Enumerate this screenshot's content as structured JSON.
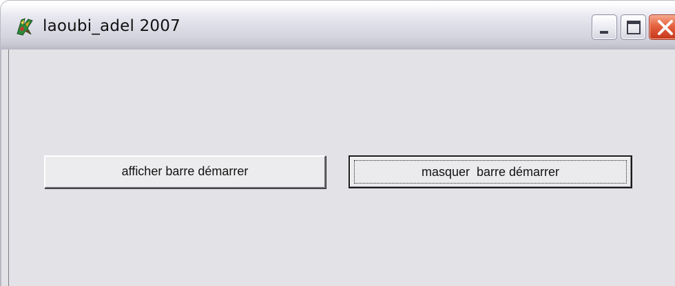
{
  "window": {
    "title": "laoubi_adel 2007"
  },
  "titlebar": {
    "icon": "app-icon",
    "controls": {
      "minimize_icon": "minimize-icon",
      "maximize_icon": "maximize-icon",
      "close_icon": "close-icon"
    }
  },
  "main": {
    "buttons": {
      "show_taskbar": "afficher barre démarrer",
      "hide_taskbar": "masquer  barre démarrer"
    }
  },
  "colors": {
    "client_background": "#e3e3e7",
    "close_button": "#e5623f"
  }
}
